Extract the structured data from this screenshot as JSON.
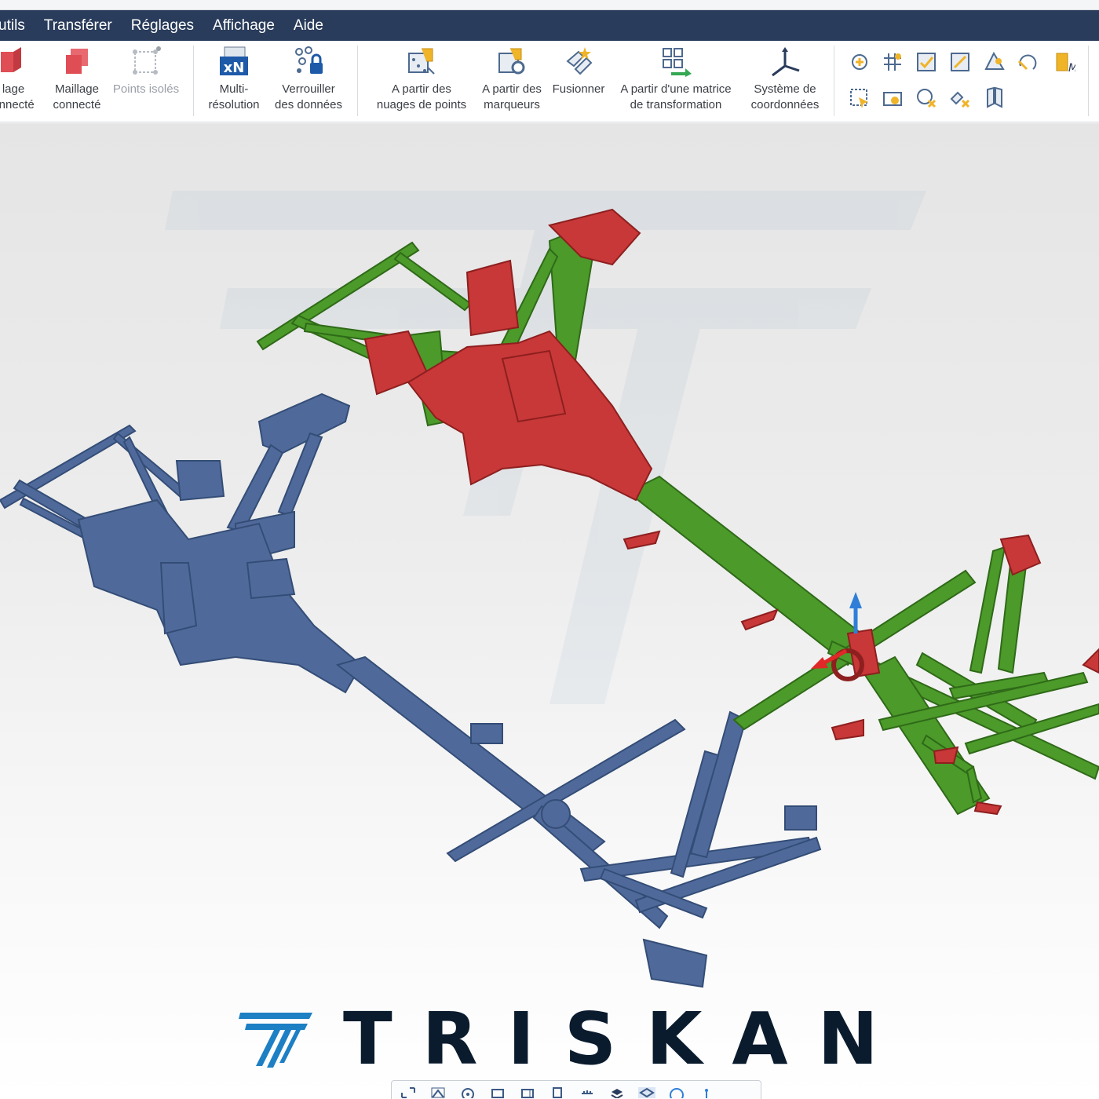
{
  "menu": {
    "items": [
      "utils",
      "Transférer",
      "Réglages",
      "Affichage",
      "Aide"
    ]
  },
  "ribbon": {
    "mesh_group": {
      "item1": "lage\nonnecté",
      "item2": "Maillage\nconnecté",
      "item3": "Points isolés"
    },
    "data_group": {
      "multi": "Multi-\nrésolution",
      "lock": "Verrouiller\ndes données"
    },
    "align_group": {
      "cloud": "A partir des\nnuages de points",
      "markers": "A partir des\nmarqueurs",
      "merge": "Fusionner",
      "matrix": "A partir d'une matrice\nde transformation",
      "coords": "Système de\ncoordonnées"
    },
    "small_tool_icons": [
      "add-feature-icon",
      "grid-icon",
      "check-align-icon",
      "transform-icon",
      "plane-icon",
      "rotate-icon",
      "manual-icon",
      "select-icon",
      "rectangle-icon",
      "circle-delete-icon",
      "point-delete-icon",
      "split-icon"
    ]
  },
  "viewport": {
    "scan_color": "#4f6a9a",
    "cad_green": "#4c9a2a",
    "cad_red": "#c83838",
    "gizmo_z_color": "#2f7fd8",
    "gizmo_x_color": "#e02828"
  },
  "brand": {
    "name": "TRISKAN",
    "logo_color": "#1d7fc4",
    "text_color": "#0b1b2e"
  },
  "bottom_toolbar": {
    "icons": [
      "fit-view-icon",
      "home-view-icon",
      "target-icon",
      "view-front-icon",
      "view-side-icon",
      "view-back-icon",
      "ruler-icon",
      "layers-icon",
      "select-box-icon",
      "sphere-icon",
      "axis-icon"
    ]
  }
}
